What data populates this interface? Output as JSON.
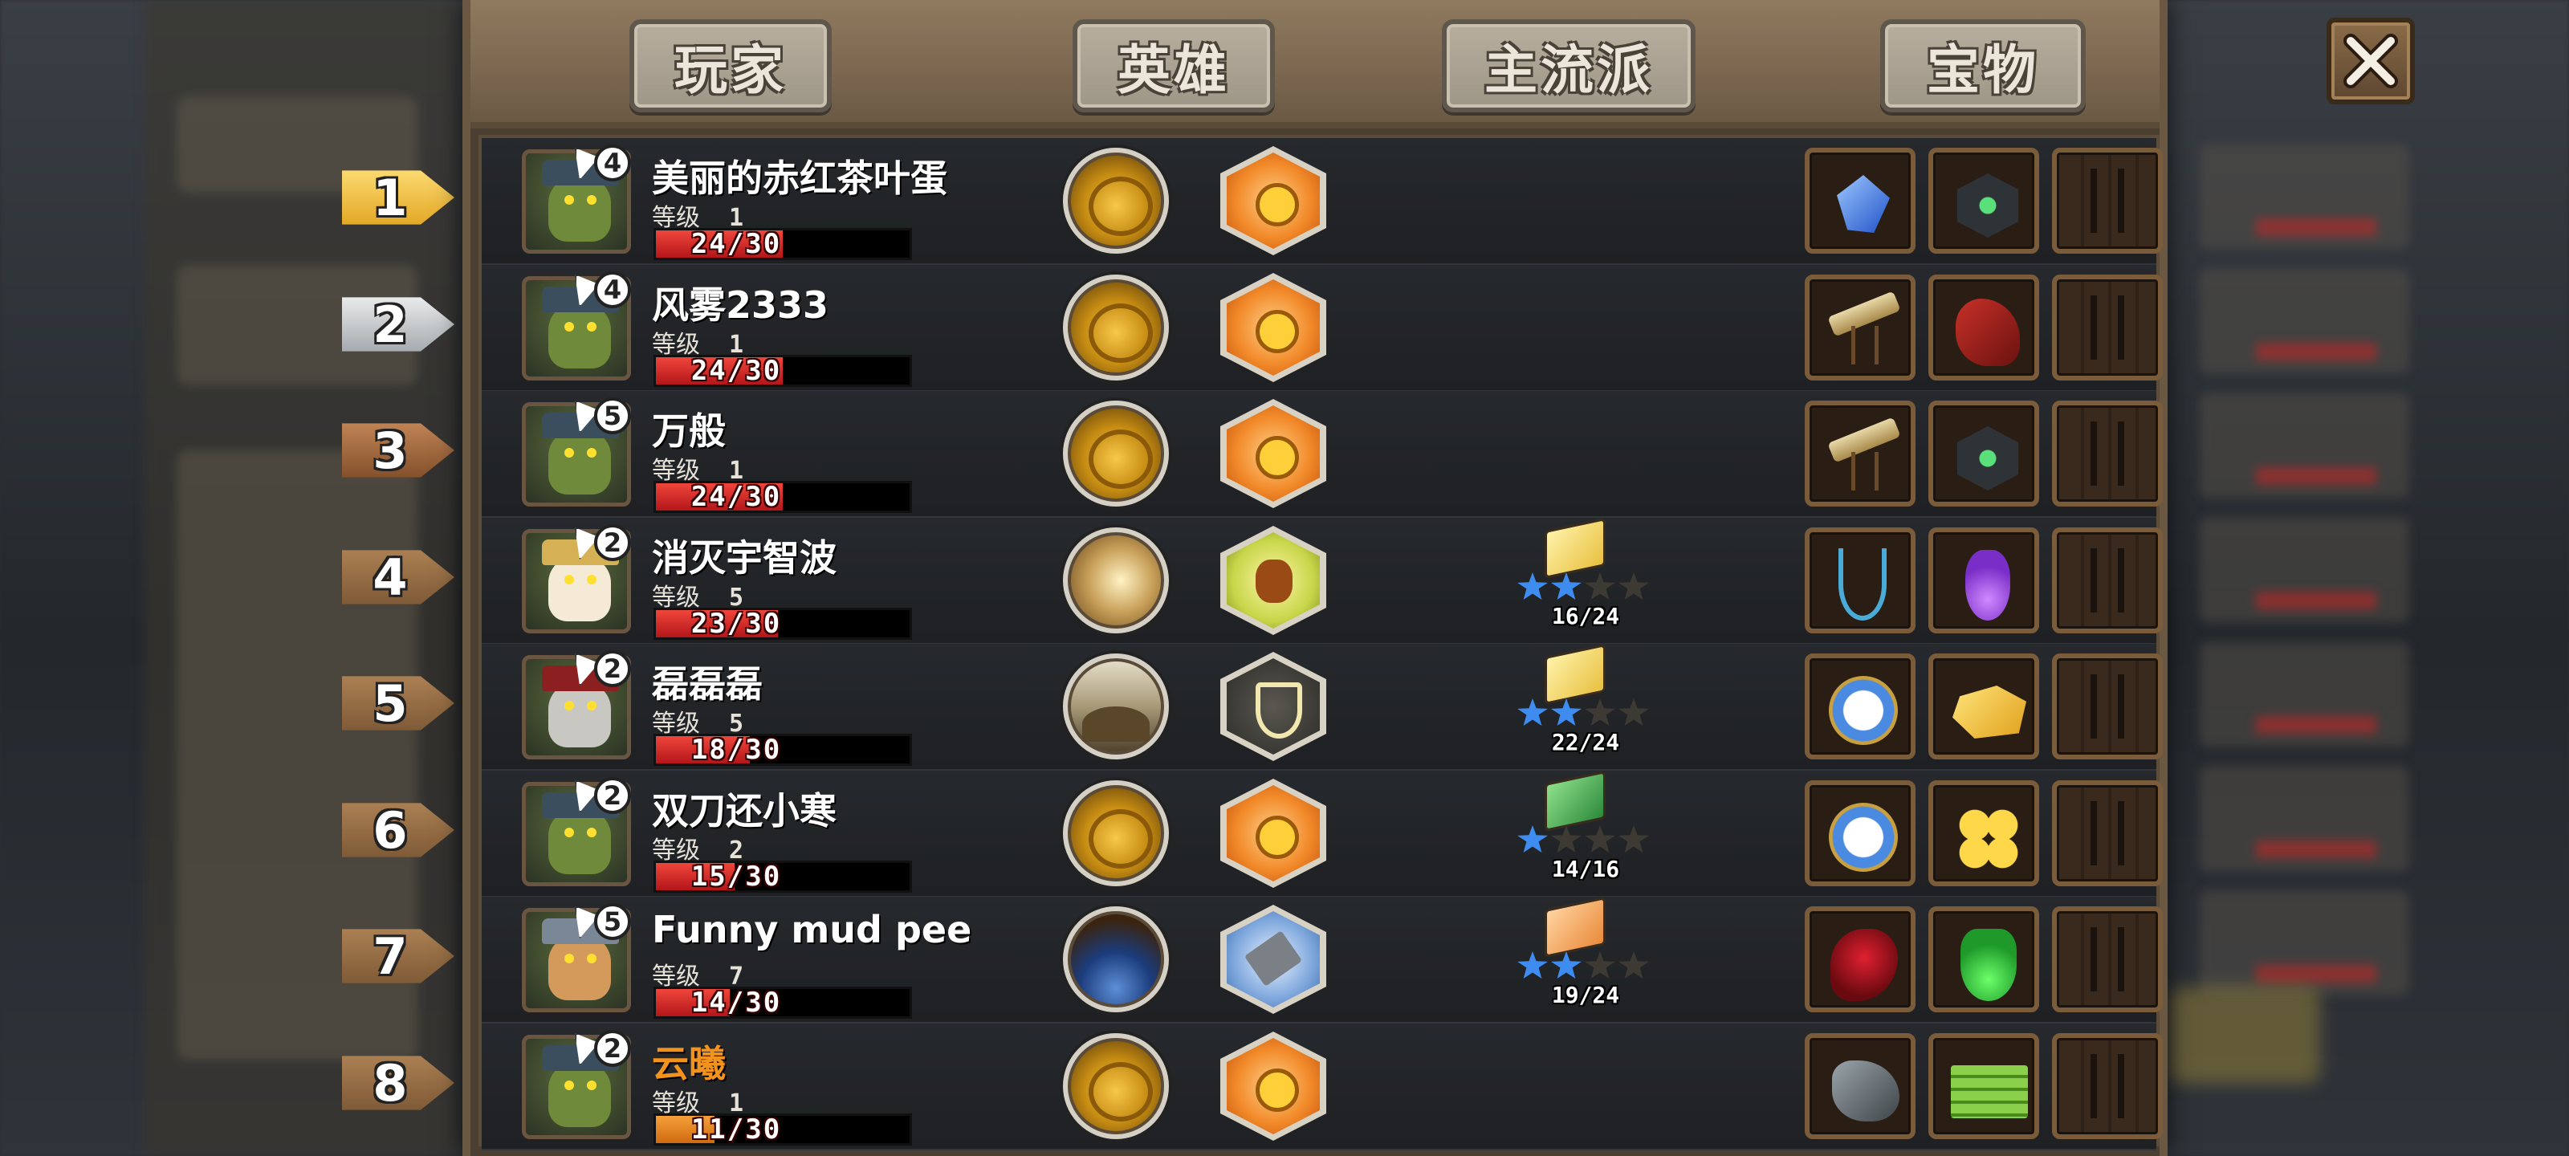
{
  "tabs": [
    {
      "label": "玩家"
    },
    {
      "label": "英雄"
    },
    {
      "label": "主流派"
    },
    {
      "label": "宝物"
    }
  ],
  "close_icon": "close-icon",
  "level_label": "等级",
  "rows": [
    {
      "rank": "1",
      "rank_style": "gold",
      "avatar": "goblin",
      "hero_level": "4",
      "name": "美丽的赤红茶叶蛋",
      "level": "1",
      "hp_text": "24/30",
      "hp_fraction": 0.8,
      "bar_color": "red",
      "skill": "coins",
      "hex": "orange",
      "book": null,
      "items": [
        "gem-icon",
        "hex-gem-icon",
        "empty"
      ]
    },
    {
      "rank": "2",
      "rank_style": "silver",
      "avatar": "goblin",
      "hero_level": "4",
      "name": "风雾2333",
      "level": "1",
      "hp_text": "24/30",
      "hp_fraction": 0.8,
      "bar_color": "red",
      "skill": "coins",
      "hex": "orange",
      "book": null,
      "items": [
        "telescope-icon",
        "rocket-icon",
        "empty"
      ]
    },
    {
      "rank": "3",
      "rank_style": "bronze",
      "avatar": "goblin",
      "hero_level": "5",
      "name": "万般",
      "level": "1",
      "hp_text": "24/30",
      "hp_fraction": 0.8,
      "bar_color": "red",
      "skill": "coins",
      "hex": "orange",
      "book": null,
      "items": [
        "telescope-icon",
        "hex-gem-icon",
        "empty"
      ]
    },
    {
      "rank": "4",
      "rank_style": "wood",
      "avatar": "panda",
      "hero_level": "2",
      "name": "消灭宇智波",
      "level": "5",
      "hp_text": "23/30",
      "hp_fraction": 0.767,
      "bar_color": "red",
      "skill": "swirl",
      "hex": "green",
      "book": {
        "color": "yellow",
        "stars": 2,
        "max_stars": 4,
        "progress": "16/24"
      },
      "items": [
        "anchor-icon",
        "potion-icon",
        "empty"
      ]
    },
    {
      "rank": "5",
      "rank_style": "wood",
      "avatar": "knight",
      "hero_level": "2",
      "name": "磊磊磊",
      "level": "5",
      "hp_text": "18/30",
      "hp_fraction": 0.6,
      "bar_color": "red",
      "skill": "arch",
      "hex": "dark",
      "book": {
        "color": "yellow",
        "stars": 2,
        "max_stars": 4,
        "progress": "22/24"
      },
      "items": [
        "compass-icon",
        "gold-nugget-icon",
        "empty"
      ]
    },
    {
      "rank": "6",
      "rank_style": "wood",
      "avatar": "goblin",
      "hero_level": "2",
      "name": "双刀还小寒",
      "level": "2",
      "hp_text": "15/30",
      "hp_fraction": 0.5,
      "bar_color": "red",
      "skill": "coins",
      "hex": "orange",
      "book": {
        "color": "green",
        "stars": 1,
        "max_stars": 4,
        "progress": "14/16"
      },
      "items": [
        "compass-icon",
        "clover-icon",
        "empty"
      ]
    },
    {
      "rank": "7",
      "rank_style": "wood",
      "avatar": "dwarf",
      "hero_level": "5",
      "name": "Funny mud pee",
      "level": "7",
      "hp_text": "14/30",
      "hp_fraction": 0.467,
      "bar_color": "red",
      "skill": "dark",
      "hex": "blue",
      "book": {
        "color": "orange",
        "stars": 2,
        "max_stars": 4,
        "progress": "19/24"
      },
      "items": [
        "blood-icon",
        "flask-icon",
        "empty"
      ]
    },
    {
      "rank": "8",
      "rank_style": "wood",
      "avatar": "goblin",
      "hero_level": "2",
      "name": "云曦",
      "name_color": "orange",
      "level": "1",
      "hp_text": "11/30",
      "hp_fraction": 0.367,
      "bar_color": "orange",
      "skill": "coins",
      "hex": "orange",
      "book": null,
      "items": [
        "claw-icon",
        "cash-icon",
        "empty"
      ]
    }
  ]
}
